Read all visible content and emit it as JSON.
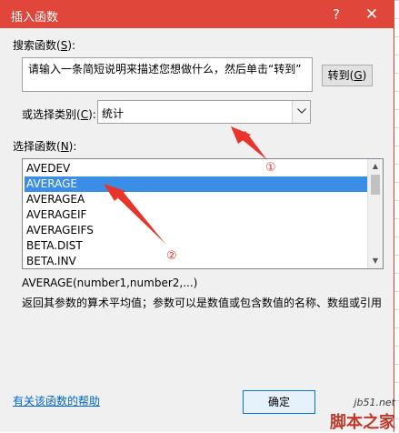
{
  "window": {
    "title": "插入函数",
    "help_glyph": "?",
    "close_glyph": "✕"
  },
  "search": {
    "label_prefix": "搜索函数(",
    "label_key": "S",
    "label_suffix": "):",
    "value": "请输入一条简短说明来描述您想做什么，然后单击“转到”",
    "goto_prefix": "转到(",
    "goto_key": "G",
    "goto_suffix": ")"
  },
  "category": {
    "label_prefix": "或选择类别(",
    "label_key": "C",
    "label_suffix": "):",
    "selected": "统计",
    "arrow_icon": "chevron-down-icon"
  },
  "functions": {
    "label_prefix": "选择函数(",
    "label_key": "N",
    "label_suffix": "):",
    "items": [
      "AVEDEV",
      "AVERAGE",
      "AVERAGEA",
      "AVERAGEIF",
      "AVERAGEIFS",
      "BETA.DIST",
      "BETA.INV"
    ],
    "selected_index": 1
  },
  "detail": {
    "syntax": "AVERAGE(number1,number2,...)",
    "description": "返回其参数的算术平均值；参数可以是数值或包含数值的名称、数组或引用"
  },
  "footer": {
    "help_link": "有关该函数的帮助",
    "ok_label": "确定"
  },
  "annotations": {
    "marker1": "①",
    "marker2": "②",
    "color": "#e8342a"
  },
  "watermark": {
    "site": "jb51.net",
    "brand": "脚本之家"
  }
}
